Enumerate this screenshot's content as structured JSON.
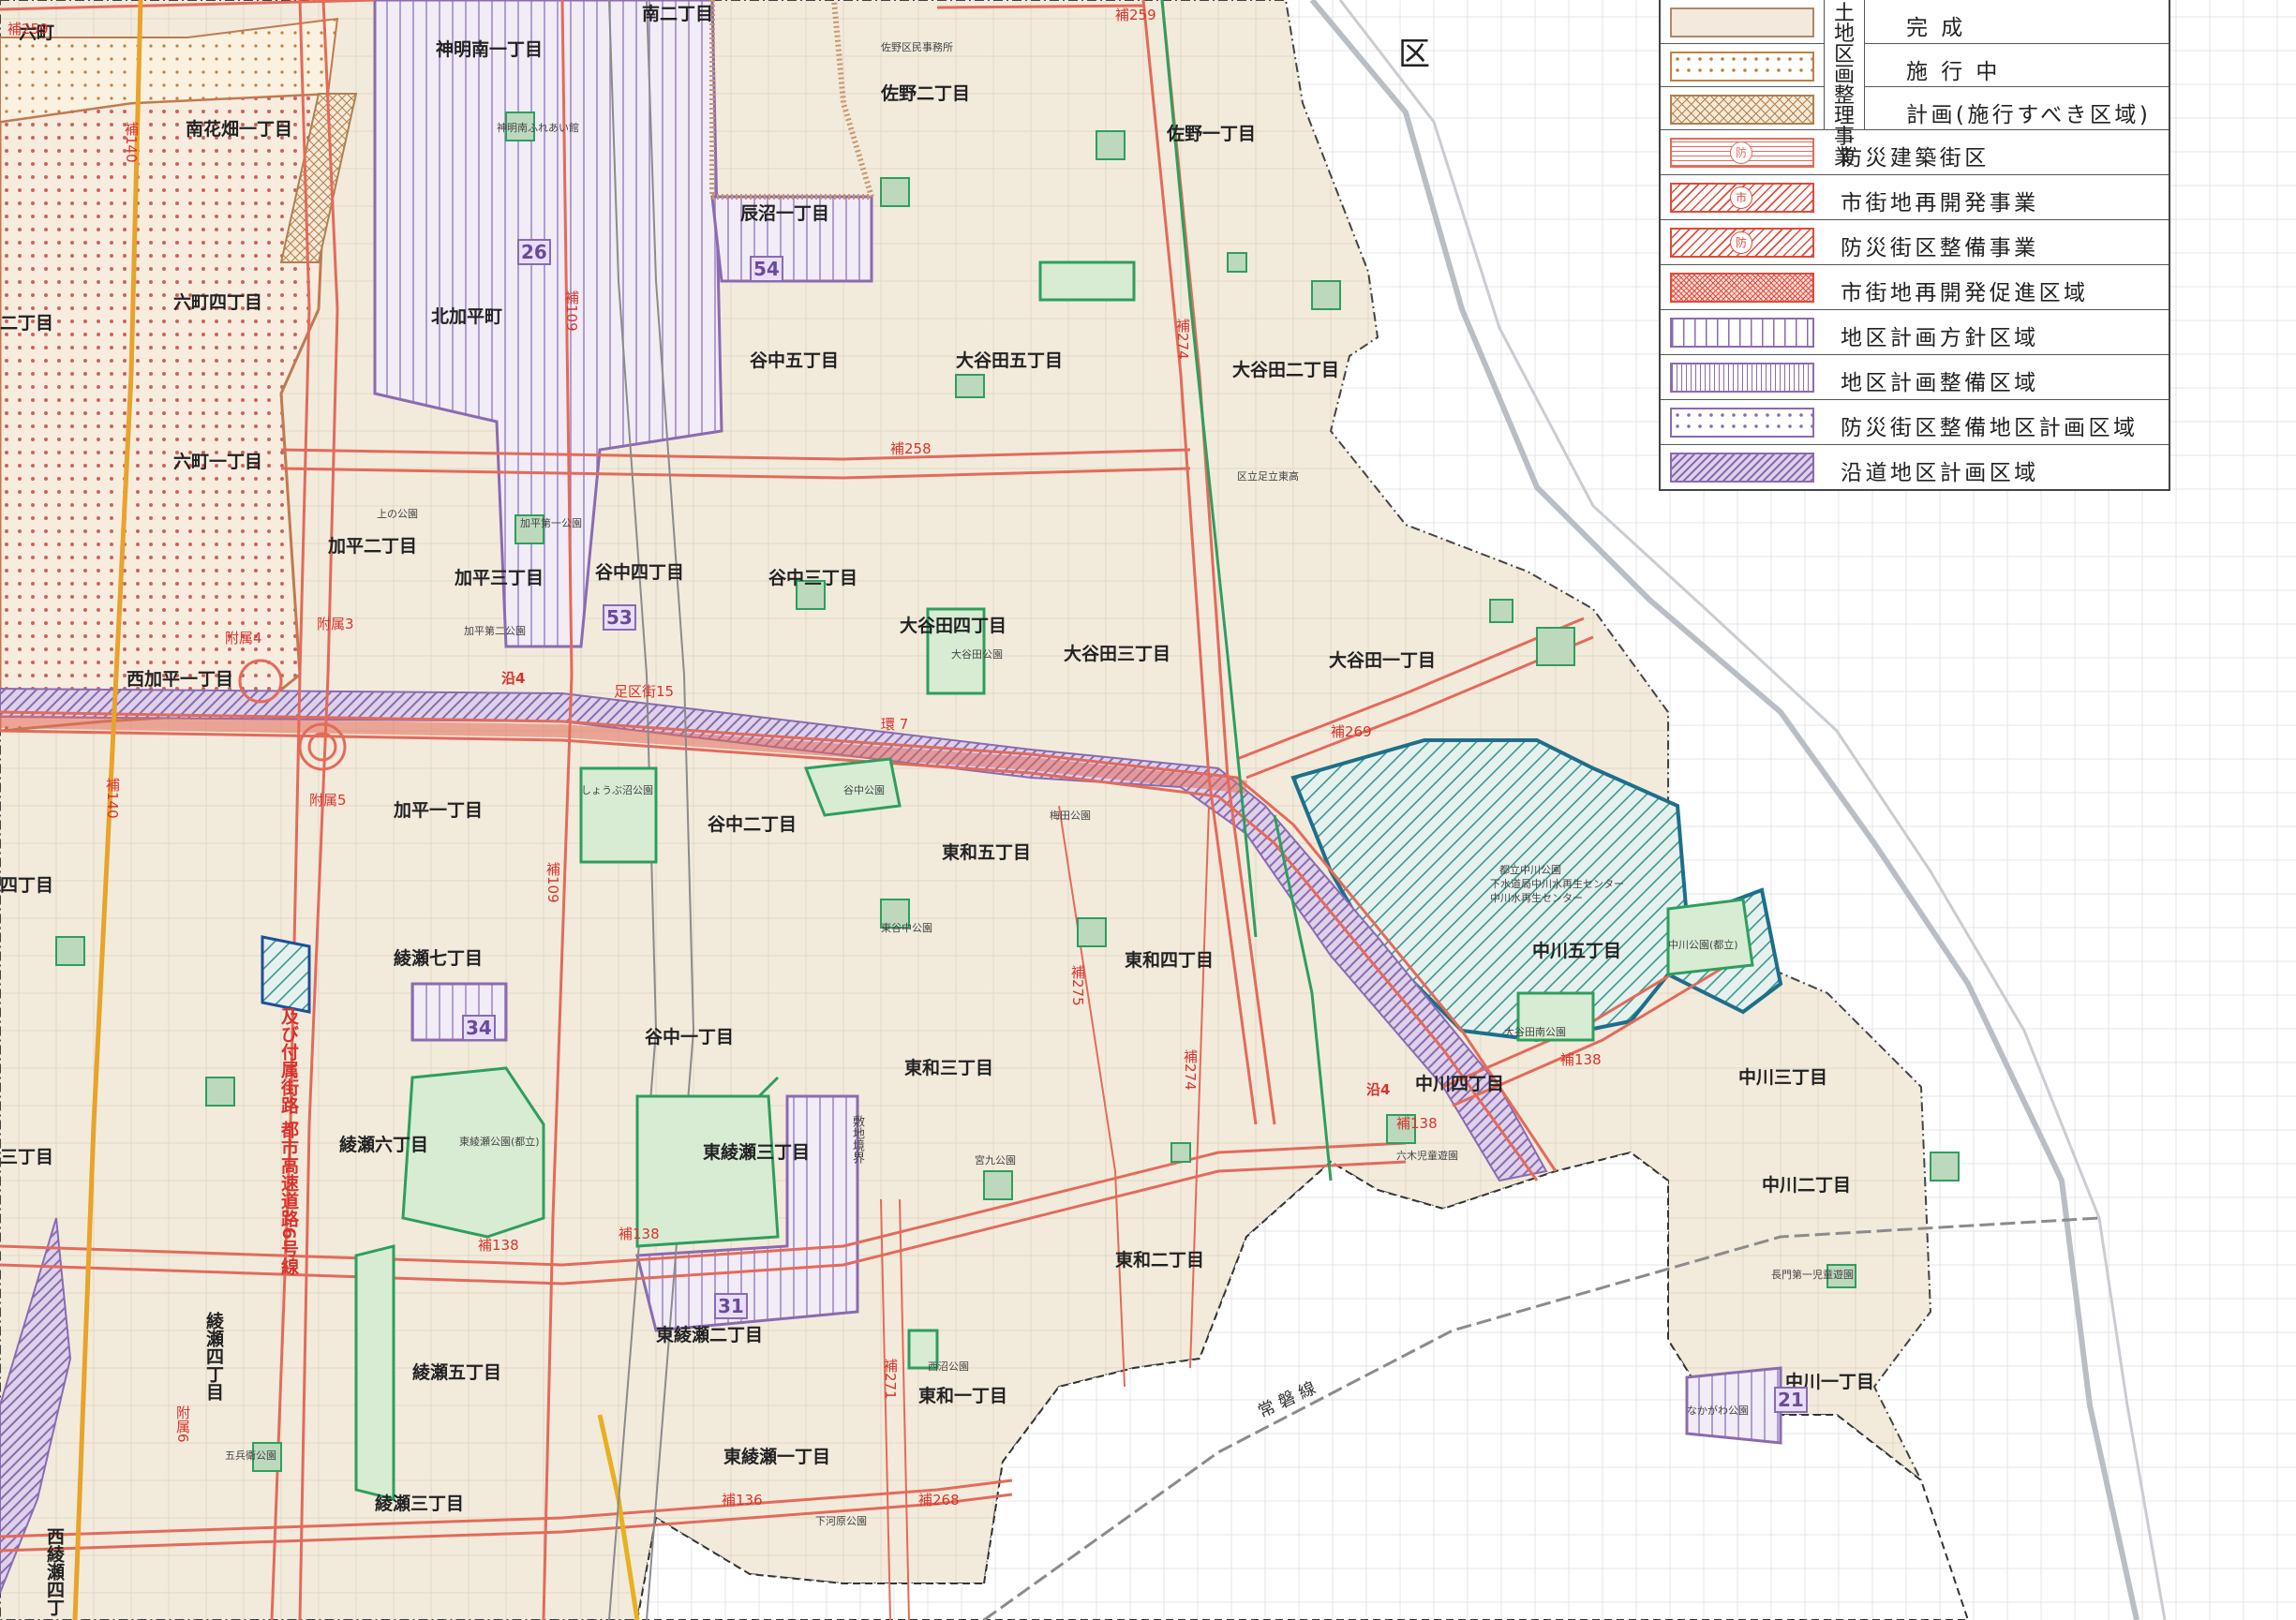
{
  "ward_label": "区",
  "legend": {
    "group_label_a": "土地区画整理事業",
    "land_readjustment": [
      {
        "label": "完 成",
        "pattern": "plain",
        "fill": "#f3e9dc",
        "stroke": "#b08868"
      },
      {
        "label": "施 行 中",
        "pattern": "dots",
        "fill": "#fbf1e0",
        "stroke": "#c08040"
      },
      {
        "label": "計画(施行すべき区域)",
        "pattern": "cross",
        "fill": "#f7ead7",
        "stroke": "#b08050"
      }
    ],
    "items": [
      {
        "label": "防災建築街区",
        "pattern": "hlines-mark",
        "mark": "防",
        "color": "#e46a5a"
      },
      {
        "label": "市街地再開発事業",
        "pattern": "diag-mark",
        "mark": "市",
        "color": "#e04a3a"
      },
      {
        "label": "防災街区整備事業",
        "pattern": "diag-mark",
        "mark": "防",
        "color": "#e04a3a"
      },
      {
        "label": "市街地再開発促進区域",
        "pattern": "grid",
        "color": "#e04a3a"
      },
      {
        "label": "地区計画方針区域",
        "pattern": "vlines",
        "color": "#8a6bb0"
      },
      {
        "label": "地区計画整備区域",
        "pattern": "vlines-dense",
        "color": "#8a6bb0"
      },
      {
        "label": "防災街区整備地区計画区域",
        "pattern": "dots",
        "color": "#8a6bb0"
      },
      {
        "label": "沿道地区計画区域",
        "pattern": "diag-purple",
        "color": "#8a6bb0"
      }
    ]
  },
  "districts": [
    {
      "name": "神明南一丁目"
    },
    {
      "name": "南二丁目"
    },
    {
      "name": "佐野二丁目"
    },
    {
      "name": "佐野一丁目"
    },
    {
      "name": "南花畑一丁目"
    },
    {
      "name": "辰沼一丁目"
    },
    {
      "name": "六町四丁目"
    },
    {
      "name": "北加平町"
    },
    {
      "name": "谷中五丁目"
    },
    {
      "name": "大谷田五丁目"
    },
    {
      "name": "大谷田二丁目"
    },
    {
      "name": "六町一丁目"
    },
    {
      "name": "加平二丁目"
    },
    {
      "name": "加平三丁目"
    },
    {
      "name": "谷中四丁目"
    },
    {
      "name": "谷中三丁目"
    },
    {
      "name": "大谷田四丁目"
    },
    {
      "name": "大谷田三丁目"
    },
    {
      "name": "大谷田一丁目"
    },
    {
      "name": "西加平一丁目"
    },
    {
      "name": "加平一丁目"
    },
    {
      "name": "谷中二丁目"
    },
    {
      "name": "東和五丁目"
    },
    {
      "name": "中川五丁目"
    },
    {
      "name": "綾瀬七丁目"
    },
    {
      "name": "東和四丁目"
    },
    {
      "name": "谷中一丁目"
    },
    {
      "name": "東和三丁目"
    },
    {
      "name": "中川四丁目"
    },
    {
      "name": "中川三丁目"
    },
    {
      "name": "綾瀬六丁目"
    },
    {
      "name": "東綾瀬三丁目"
    },
    {
      "name": "中川二丁目"
    },
    {
      "name": "東和二丁目"
    },
    {
      "name": "綾瀬四丁目"
    },
    {
      "name": "綾瀬五丁目"
    },
    {
      "name": "東綾瀬二丁目"
    },
    {
      "name": "東和一丁目"
    },
    {
      "name": "中川一丁目"
    },
    {
      "name": "東綾瀬一丁目"
    },
    {
      "name": "綾瀬三丁目"
    },
    {
      "name": "西綾瀬四丁"
    },
    {
      "name": "二丁目"
    },
    {
      "name": "四丁目"
    },
    {
      "name": "三丁目"
    },
    {
      "name": "六町"
    }
  ],
  "roads": {
    "ho259": "補259",
    "ho140": "補140",
    "ho109": "補109",
    "ho258": "補258",
    "ho274": "補274",
    "ho269": "補269",
    "ho138": "補138",
    "ho275": "補275",
    "ho271": "補271",
    "ho136": "補136",
    "ho268": "補268",
    "kan7": "環 7",
    "fuzoku3": "附属3",
    "fuzoku4": "附属4",
    "fuzoku5": "附属5",
    "fuzoku6": "附属6",
    "expressway": "及び付属街路 都市高速道路6号線",
    "en4a": "沿4",
    "en4b": "沿4",
    "teikukai": "足区街15",
    "ho109b": "補109"
  },
  "badges": [
    "26",
    "54",
    "53",
    "34",
    "31",
    "21"
  ],
  "facilities": [
    {
      "name": "佐野区民事務所"
    },
    {
      "name": "神明南ふれあい館"
    },
    {
      "name": "上の公園"
    },
    {
      "name": "加平第一公園"
    },
    {
      "name": "加平第二公園"
    },
    {
      "name": "大谷田公園"
    },
    {
      "name": "谷中公園"
    },
    {
      "name": "梅田公園"
    },
    {
      "name": "東谷中公園"
    },
    {
      "name": "しょうぶ沼公園"
    },
    {
      "name": "下水道局中川水再生センター"
    },
    {
      "name": "都立中川公園"
    },
    {
      "name": "大谷田南公園"
    },
    {
      "name": "中川公園(都立)"
    },
    {
      "name": "東綾瀬公園(都立)"
    },
    {
      "name": "宮九公園"
    },
    {
      "name": "西沼公園"
    },
    {
      "name": "下河原公園"
    },
    {
      "name": "六木児童遊園"
    },
    {
      "name": "長門第一児童遊園"
    },
    {
      "name": "なかがわ公園"
    },
    {
      "name": "五兵衛公園"
    },
    {
      "name": "中川水再生センター"
    },
    {
      "name": "区立足立東高"
    }
  ],
  "rail_labels": {
    "joban": "常 磐 線",
    "kei": "敷地境界"
  },
  "colors": {
    "base": "#f2ebdc",
    "complete": "#f3e9dc",
    "road_red": "#e46a5a",
    "purple": "#8a6bb0",
    "park_green": "#2e9e5e",
    "teal": "#1e8a8a",
    "orange_line": "#e8a32a",
    "river": "#9aa0a6"
  }
}
